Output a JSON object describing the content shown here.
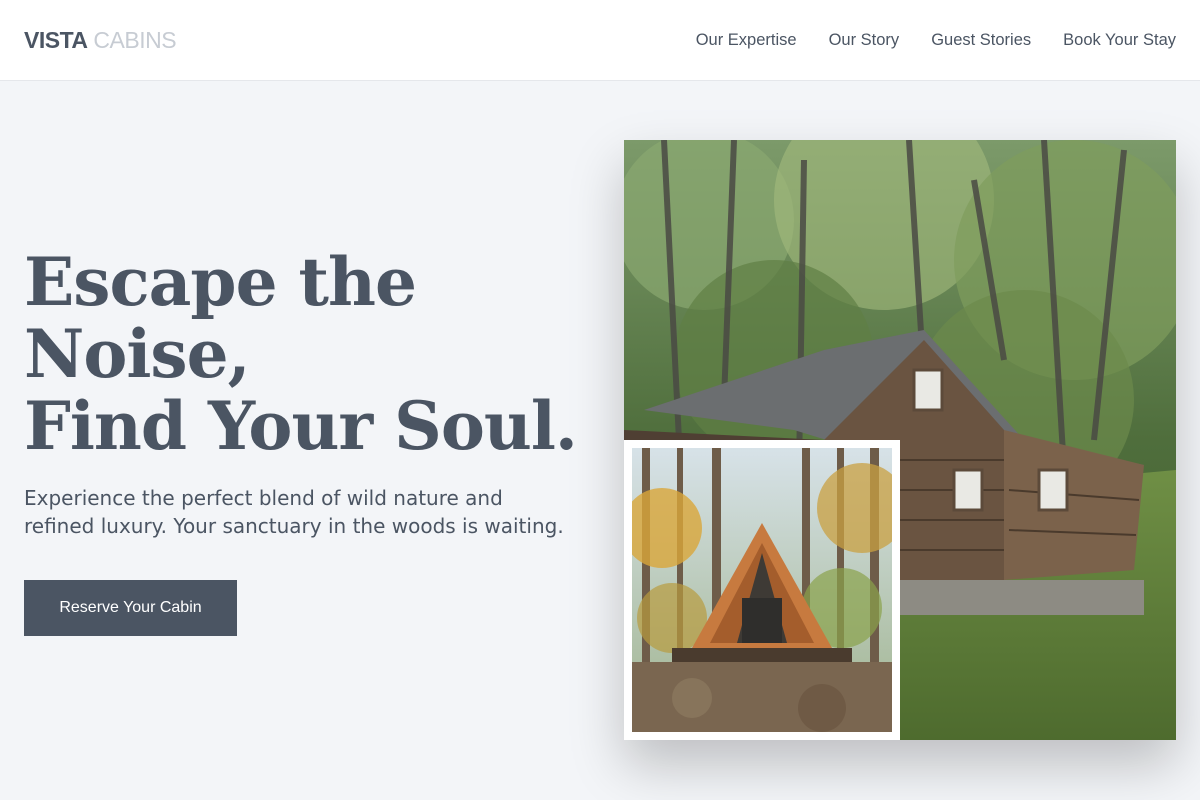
{
  "brand": {
    "primary": "VISTA",
    "secondary": " CABINS"
  },
  "nav": {
    "items": [
      {
        "label": "Our Expertise"
      },
      {
        "label": "Our Story"
      },
      {
        "label": "Guest Stories"
      },
      {
        "label": "Book Your Stay"
      }
    ]
  },
  "hero": {
    "title_lines": [
      "Escape the",
      "Noise,",
      "Find Your Soul."
    ],
    "subtitle": "Experience the perfect blend of wild nature and refined luxury. Your sanctuary in the woods is waiting.",
    "cta_label": "Reserve Your Cabin"
  },
  "colors": {
    "background": "#f3f5f8",
    "text": "#4b5563",
    "logo_light": "#c7ccd3",
    "button": "#4b5563"
  }
}
